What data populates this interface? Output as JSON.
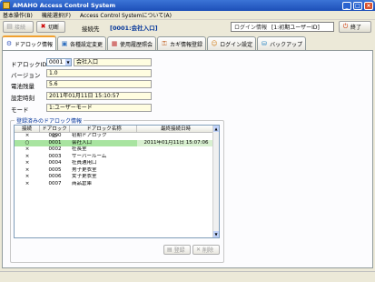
{
  "window": {
    "title": "AMAHO  Access Control System"
  },
  "menu": [
    "基本操作(B)",
    "機能選択(F)",
    "Access Control Systemについて(A)"
  ],
  "toolbar": {
    "connect_label": "接続",
    "disconnect_label": "切断",
    "destination_label": "接続先",
    "destination_value": "[0001:会社入口]",
    "login_label": "ログイン情報",
    "login_value": "[1:初期ユーザーID]",
    "exit_label": "終了"
  },
  "tabs": [
    {
      "label": "ドアロック情報",
      "icon": "lock-icon"
    },
    {
      "label": "各種設定変更",
      "icon": "settings-icon"
    },
    {
      "label": "使用履歴照会",
      "icon": "history-icon"
    },
    {
      "label": "カギ情報登録",
      "icon": "key-icon"
    },
    {
      "label": "ログイン設定",
      "icon": "login-icon"
    },
    {
      "label": "バックアップ",
      "icon": "backup-icon"
    }
  ],
  "form": {
    "doorlock_id_label": "ドアロックID",
    "doorlock_id_value": "0001",
    "doorlock_name": "会社入口",
    "version_label": "バージョン",
    "version_value": "1.0",
    "battery_label": "電池残量",
    "battery_value": "5.6",
    "clock_label": "設定時刻",
    "clock_value": "2011年01月11日 15:10:57",
    "mode_label": "モード",
    "mode_value": "1:ユーザーモード"
  },
  "registered": {
    "title": "登録済みのドアロック情報",
    "columns": [
      "接続",
      "ドアロックID",
      "ドアロック名称",
      "最終接続日時"
    ],
    "rows": [
      {
        "connected": "×",
        "id": "0000",
        "name": "初期ドアロック",
        "last": ""
      },
      {
        "connected": "○",
        "id": "0001",
        "name": "会社入口",
        "last": "2011年01月11日 15:07:06"
      },
      {
        "connected": "×",
        "id": "0002",
        "name": "社長室",
        "last": ""
      },
      {
        "connected": "×",
        "id": "0003",
        "name": "サーバールーム",
        "last": ""
      },
      {
        "connected": "×",
        "id": "0004",
        "name": "社員通用口",
        "last": ""
      },
      {
        "connected": "×",
        "id": "0005",
        "name": "男子更衣室",
        "last": ""
      },
      {
        "connected": "×",
        "id": "0006",
        "name": "女子更衣室",
        "last": ""
      },
      {
        "connected": "×",
        "id": "0007",
        "name": "商品倉庫",
        "last": ""
      }
    ],
    "register_label": "登録",
    "delete_label": "削除"
  }
}
